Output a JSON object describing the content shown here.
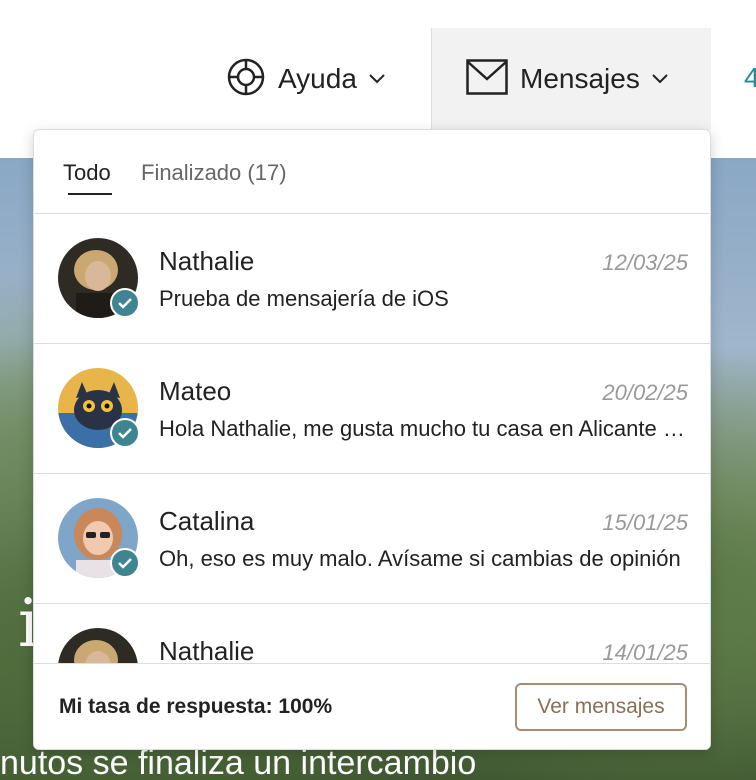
{
  "nav": {
    "help_label": "Ayuda",
    "messages_label": "Mensajes",
    "partial_label": "4"
  },
  "background": {
    "letter": "i",
    "caption": "nutos se finaliza un intercambio"
  },
  "tabs": [
    {
      "label": "Todo",
      "active": true
    },
    {
      "label": "Finalizado (17)",
      "active": false
    }
  ],
  "messages": [
    {
      "name": "Nathalie",
      "date": "12/03/25",
      "preview": "Prueba de mensajería de iOS"
    },
    {
      "name": "Mateo",
      "date": "20/02/25",
      "preview": "Hola Nathalie, me gusta mucho tu casa en Alicante y me encantaría hacer un intercambio"
    },
    {
      "name": "Catalina",
      "date": "15/01/25",
      "preview": "Oh, eso es muy malo. Avísame si cambias de opinión"
    },
    {
      "name": "Nathalie",
      "date": "14/01/25",
      "preview": ""
    }
  ],
  "footer": {
    "response_rate": "Mi tasa de respuesta: 100%",
    "view_button": "Ver mensajes"
  },
  "colors": {
    "accent_teal": "#3f8591",
    "button_brown": "#a68d72"
  }
}
